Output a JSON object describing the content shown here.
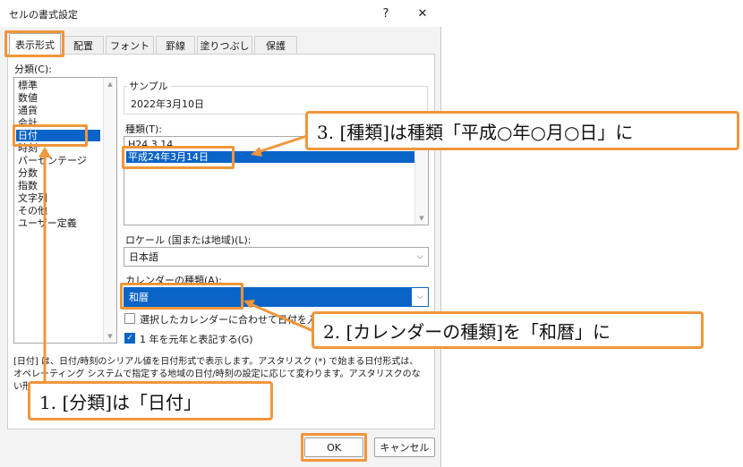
{
  "dialog": {
    "title": "セルの書式設定",
    "help_label": "?",
    "close_label": "✕",
    "tabs": [
      {
        "label": "表示形式",
        "active": true
      },
      {
        "label": "配置"
      },
      {
        "label": "フォント"
      },
      {
        "label": "罫線"
      },
      {
        "label": "塗りつぶし"
      },
      {
        "label": "保護"
      }
    ],
    "category_label": "分類(C):",
    "categories": [
      "標準",
      "数値",
      "通貨",
      "会計",
      "日付",
      "時刻",
      "パーセンテージ",
      "分数",
      "指数",
      "文字列",
      "その他",
      "ユーザー定義"
    ],
    "selected_category": "日付",
    "sample_label": "サンプル",
    "sample_value": "2022年3月10日",
    "type_label": "種類(T):",
    "types": [
      "H24.3.14",
      "平成24年3月14日"
    ],
    "selected_type": "平成24年3月14日",
    "locale_label": "ロケール (国または地域)(L):",
    "locale_value": "日本語",
    "calendar_label": "カレンダーの種類(A):",
    "calendar_value": "和暦",
    "checkbox1_label": "選択したカレンダーに合わせて日付を入力する",
    "checkbox2_label": "1 年を元年と表記する(G)",
    "description": "[日付] は、日付/時刻のシリアル値を日付形式で表示します。アスタリスク (*) で始まる日付形式は、オペレーティング システムで指定する地域の日付/時刻の設定に応じて変わります。アスタリスクのない形式は、オペレーティング システムの設定に影響されません。",
    "ok_label": "OK",
    "cancel_label": "キャンセル"
  },
  "callouts": {
    "step1": "1. [分類]は「日付」",
    "step2": "2. [カレンダーの種類]を「和暦」に",
    "step3": "3. [種類]は種類「平成○年○月○日」に"
  },
  "colors": {
    "accent": "#f0963c",
    "selection": "#0a64c8"
  }
}
